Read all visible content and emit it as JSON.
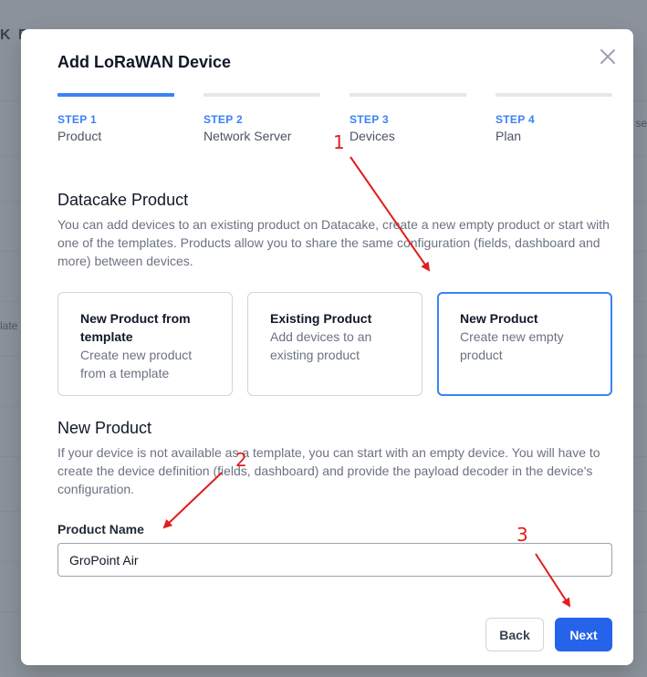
{
  "background": {
    "left_text": "K E",
    "mid_text": "late",
    "right_text": "se"
  },
  "modal": {
    "title": "Add LoRaWAN Device",
    "close_icon": "close-icon"
  },
  "steps": [
    {
      "number": "STEP 1",
      "name": "Product",
      "active": true
    },
    {
      "number": "STEP 2",
      "name": "Network Server",
      "active": false
    },
    {
      "number": "STEP 3",
      "name": "Devices",
      "active": false
    },
    {
      "number": "STEP 4",
      "name": "Plan",
      "active": false
    }
  ],
  "datacake_section": {
    "title": "Datacake Product",
    "description": "You can add devices to an existing product on Datacake, create a new empty product or start with one of the templates. Products allow you to share the same configuration (fields, dashboard and more) between devices."
  },
  "options": [
    {
      "title": "New Product from template",
      "description": "Create new product from a template",
      "selected": false
    },
    {
      "title": "Existing Product",
      "description": "Add devices to an existing product",
      "selected": false
    },
    {
      "title": "New Product",
      "description": "Create new empty product",
      "selected": true
    }
  ],
  "new_product_section": {
    "title": "New Product",
    "description": "If your device is not available as a template, you can start with an empty device. You will have to create the device definition (fields, dashboard) and provide the payload decoder in the device's configuration."
  },
  "form": {
    "product_name_label": "Product Name",
    "product_name_value": "GroPoint Air"
  },
  "buttons": {
    "back": "Back",
    "next": "Next"
  },
  "annotations": {
    "color": "#e11d1d",
    "labels": [
      "1",
      "2",
      "3"
    ]
  },
  "colors": {
    "accent": "#3b82f6",
    "primary_button": "#2563eb"
  }
}
